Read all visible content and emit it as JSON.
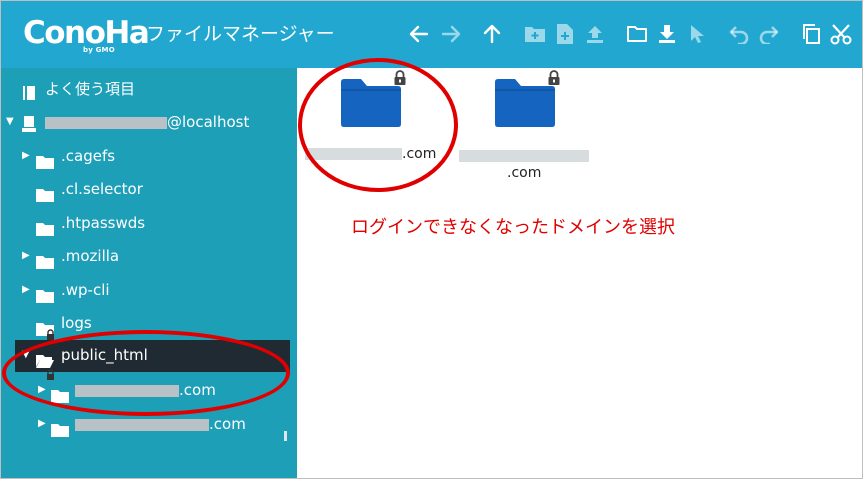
{
  "header": {
    "logo": "ConoHa",
    "logo_sub": "by GMO",
    "title": "ファイルマネージャー"
  },
  "toolbar": [
    {
      "name": "back-icon",
      "enabled": true
    },
    {
      "name": "forward-icon",
      "enabled": false
    },
    {
      "name": "up-icon",
      "enabled": true
    },
    {
      "name": "new-folder-icon",
      "enabled": false
    },
    {
      "name": "new-file-icon",
      "enabled": false
    },
    {
      "name": "upload-icon",
      "enabled": false
    },
    {
      "name": "open-folder-icon",
      "enabled": true
    },
    {
      "name": "download-icon",
      "enabled": true
    },
    {
      "name": "select-icon",
      "enabled": false
    },
    {
      "name": "undo-icon",
      "enabled": false
    },
    {
      "name": "redo-icon",
      "enabled": false
    },
    {
      "name": "copy-icon",
      "enabled": true
    },
    {
      "name": "cut-icon",
      "enabled": true
    }
  ],
  "sidebar": {
    "favorites_label": "よく使う項目",
    "host_suffix": "@localhost",
    "items": [
      {
        "label": ".cagefs"
      },
      {
        "label": ".cl.selector"
      },
      {
        "label": ".htpasswds"
      },
      {
        "label": ".mozilla"
      },
      {
        "label": ".wp-cli"
      },
      {
        "label": "logs"
      },
      {
        "label": "public_html"
      },
      {
        "suffix": ".com"
      },
      {
        "suffix": ".com"
      }
    ]
  },
  "content": {
    "folders": [
      {
        "suffix": ".com",
        "locked": true
      },
      {
        "suffix": ".com",
        "locked": true
      }
    ],
    "annotation": "ログインできなくなったドメインを選択"
  },
  "colors": {
    "header": "#22a8d0",
    "sidebar": "#1d9fb8",
    "selected": "#1f2a33",
    "folder": "#1565c0",
    "annotation": "#e10000"
  }
}
